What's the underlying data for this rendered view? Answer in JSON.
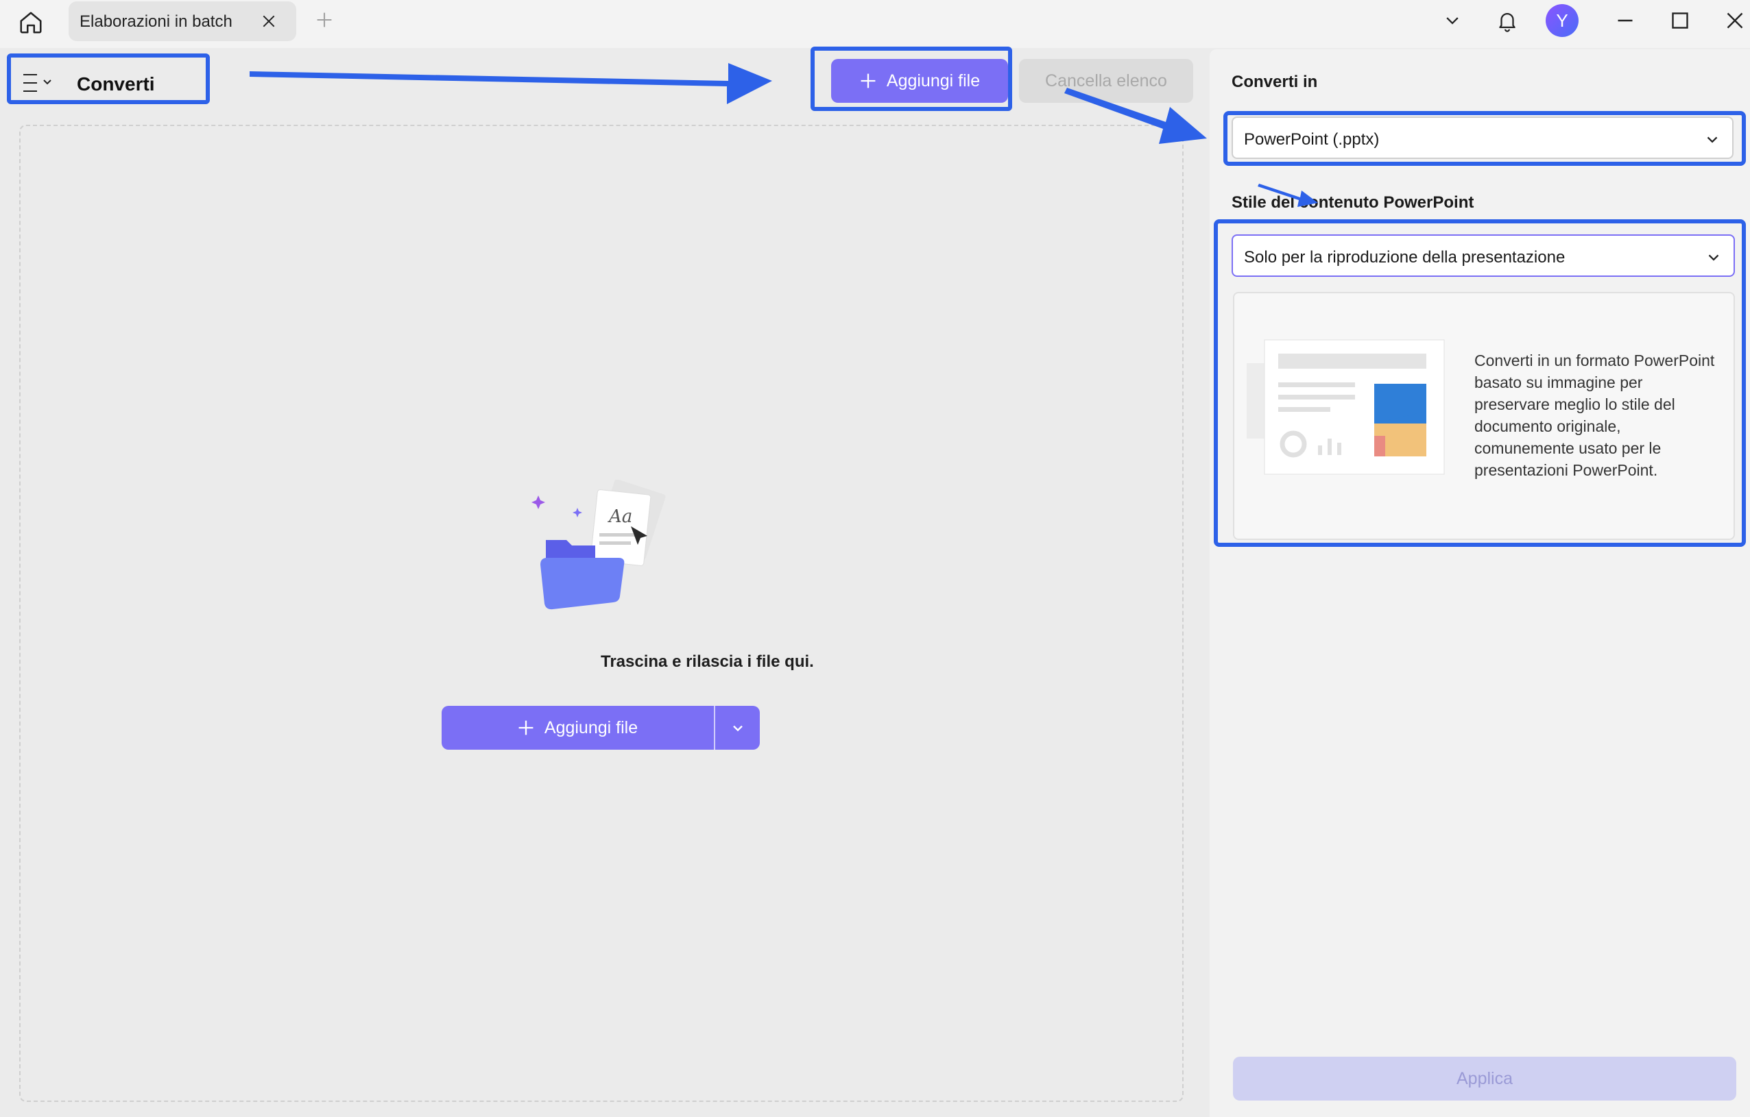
{
  "titlebar": {
    "tab_label": "Elaborazioni in batch",
    "avatar_initial": "Y"
  },
  "toolbar": {
    "menu_title": "Converti",
    "add_file_label": "Aggiungi file",
    "clear_list_label": "Cancella elenco"
  },
  "dropzone": {
    "prompt": "Trascina e rilascia i file qui.",
    "add_file_label": "Aggiungi file"
  },
  "panel": {
    "convert_to_label": "Converti in",
    "convert_to_value": "PowerPoint (.pptx)",
    "style_label": "Stile del contenuto PowerPoint",
    "style_value": "Solo per la riproduzione della presentazione",
    "style_description": "Converti in un formato PowerPoint basato su immagine per preservare meglio lo stile del documento originale, comunemente usato per le presentazioni PowerPoint.",
    "apply_label": "Applica"
  },
  "colors": {
    "accent": "#7b6ff5",
    "annotation": "#2d61e8",
    "disabled": "#cfd0f2"
  },
  "icons": [
    "home-icon",
    "close-icon",
    "plus-icon",
    "chevron-down-icon",
    "bell-icon",
    "minimize-icon",
    "maximize-icon",
    "menu-icon",
    "folder-illustration"
  ]
}
